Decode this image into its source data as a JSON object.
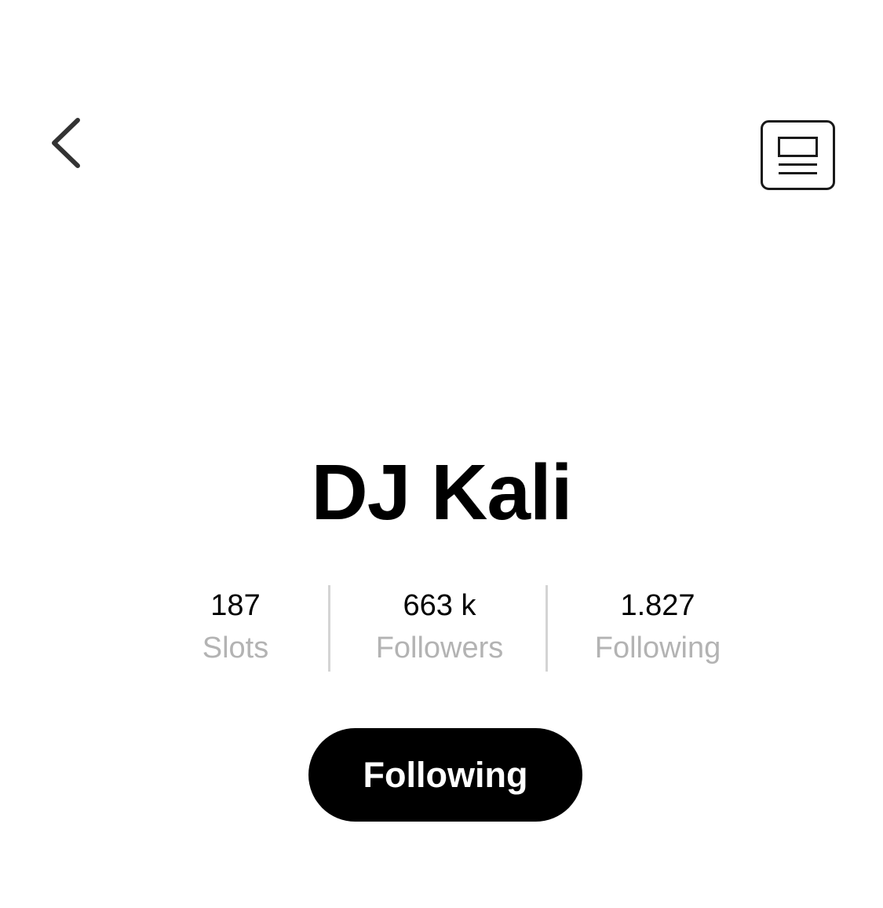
{
  "header": {
    "back_icon": "chevron-left-icon",
    "layout_icon": "article-layout-icon"
  },
  "profile": {
    "name": "DJ Kali"
  },
  "stats": [
    {
      "value": "187",
      "label": "Slots"
    },
    {
      "value": "663 k",
      "label": "Followers"
    },
    {
      "value": "1.827",
      "label": "Following"
    }
  ],
  "follow_button": {
    "label": "Following",
    "background": "#000000",
    "text_color": "#ffffff"
  },
  "colors": {
    "label_gray": "#b3b3b3",
    "divider": "#d4d4d4",
    "icon": "#333333"
  }
}
